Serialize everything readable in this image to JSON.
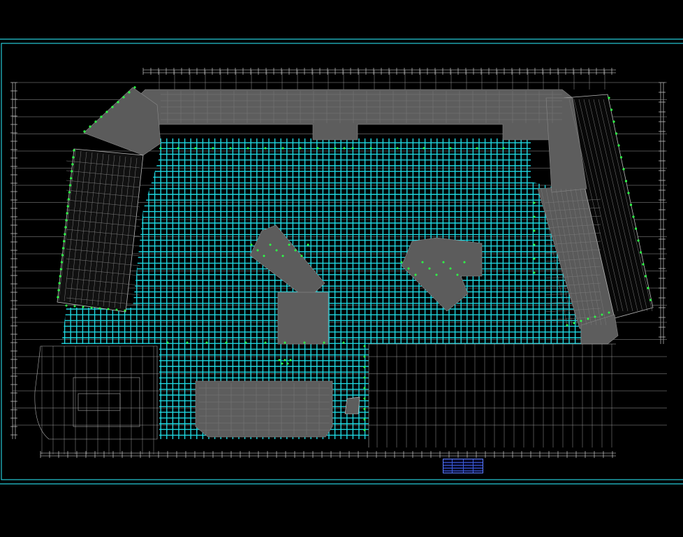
{
  "drawing": {
    "caption": "",
    "legend_title": "",
    "colors": {
      "background": "#000000",
      "frame": "#25c9d6",
      "grid": "#1fd7e0",
      "column_mark": "#2dff46",
      "building_fill": "#5d5d5d",
      "building_line": "#8a8a8a",
      "outline": "#b8b8b8",
      "dimension": "#e8e8e8"
    },
    "icons": [
      "structural-grid-icon",
      "column-marker-icon"
    ]
  }
}
